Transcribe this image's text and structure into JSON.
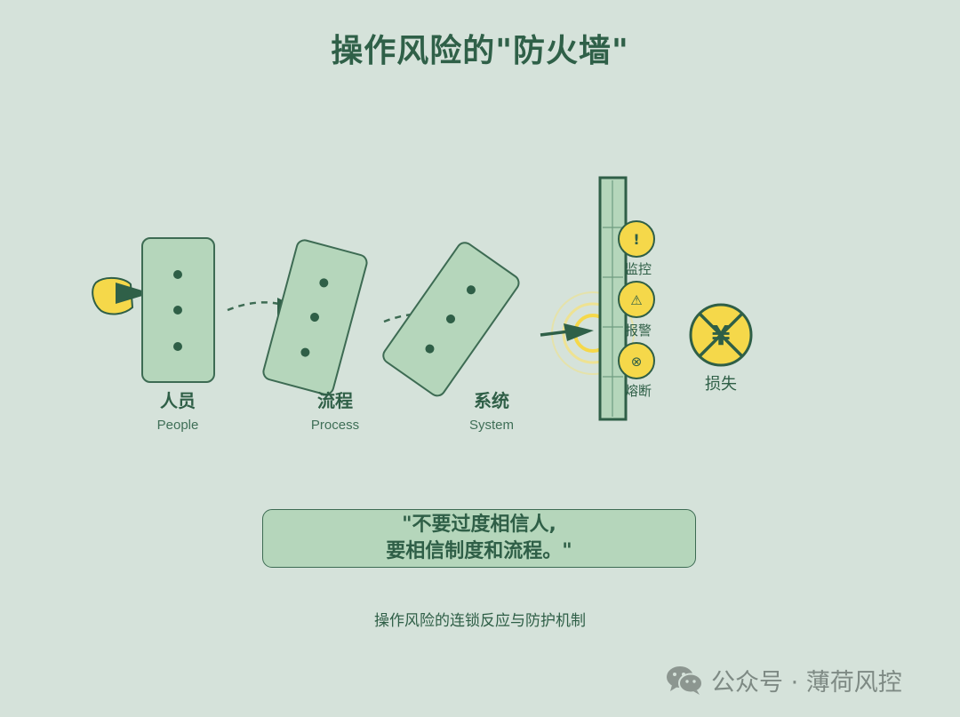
{
  "title": "操作风险的\"防火墙\"",
  "stages": [
    {
      "zh": "人员",
      "en": "People"
    },
    {
      "zh": "流程",
      "en": "Process"
    },
    {
      "zh": "系统",
      "en": "System"
    }
  ],
  "controls": [
    {
      "symbol": "!",
      "label": "监控"
    },
    {
      "symbol": "⚠",
      "label": "报警"
    },
    {
      "symbol": "⊗",
      "label": "熔断"
    }
  ],
  "loss": {
    "symbol": "¥",
    "label": "损失"
  },
  "quote": {
    "line1": "\"不要过度相信人,",
    "line2": "要相信制度和流程。\""
  },
  "caption": "操作风险的连锁反应与防护机制",
  "watermark": {
    "text": "公众号 · 薄荷风控",
    "icon": "wechat-icon"
  },
  "colors": {
    "background": "#d5e2da",
    "domino_fill": "#b5d6bb",
    "dark_green": "#2f6048",
    "accent_yellow": "#f5d84a"
  }
}
